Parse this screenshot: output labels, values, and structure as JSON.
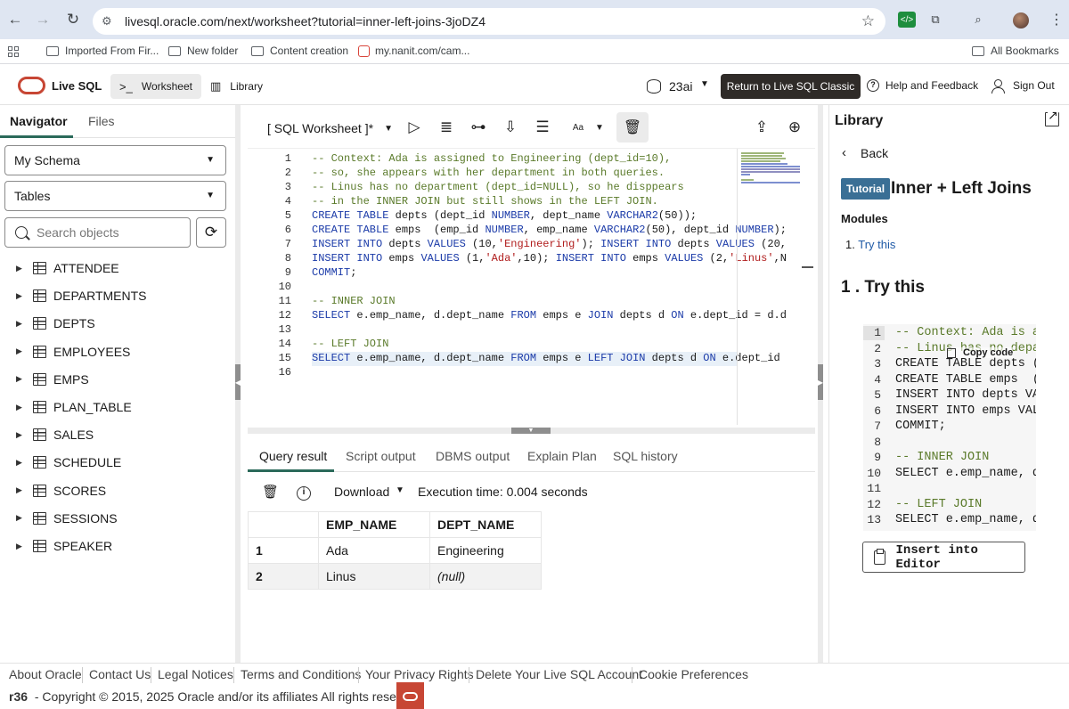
{
  "browser": {
    "url": "livesql.oracle.com/next/worksheet?tutorial=inner-left-joins-3joDZ4",
    "bookmarks": [
      "Imported From Fir...",
      "New folder",
      "Content creation",
      "my.nanit.com/cam..."
    ],
    "all_bookmarks": "All Bookmarks"
  },
  "app": {
    "name": "Live SQL",
    "tabs": [
      "Worksheet",
      "Library"
    ],
    "db_version": "23ai",
    "classic_button": "Return to Live SQL Classic",
    "help": "Help and Feedback",
    "signout": "Sign Out"
  },
  "navigator": {
    "tabs": [
      "Navigator",
      "Files"
    ],
    "schema": "My Schema",
    "object_type": "Tables",
    "search_placeholder": "Search objects",
    "tables": [
      "ATTENDEE",
      "DEPARTMENTS",
      "DEPTS",
      "EMPLOYEES",
      "EMPS",
      "PLAN_TABLE",
      "SALES",
      "SCHEDULE",
      "SCORES",
      "SESSIONS",
      "SPEAKER"
    ]
  },
  "worksheet": {
    "title": "[ SQL Worksheet ]*",
    "font_label": "Aa",
    "line_numbers": [
      "1",
      "2",
      "3",
      "4",
      "5",
      "6",
      "7",
      "8",
      "9",
      "10",
      "11",
      "12",
      "13",
      "14",
      "15",
      "16"
    ],
    "result_tabs": [
      "Query result",
      "Script output",
      "DBMS output",
      "Explain Plan",
      "SQL history"
    ],
    "download": "Download",
    "execution": "Execution time: 0.004 seconds",
    "columns": [
      "EMP_NAME",
      "DEPT_NAME"
    ],
    "rows": [
      {
        "n": "1",
        "emp": "Ada",
        "dept": "Engineering"
      },
      {
        "n": "2",
        "emp": "Linus",
        "dept": "(null)"
      }
    ]
  },
  "library": {
    "title": "Library",
    "back": "Back",
    "badge": "Tutorial",
    "tutorial_title": "Inner + Left Joins",
    "modules_heading": "Modules",
    "module_number": "1.",
    "module_link": "Try this",
    "section_heading": "1 . Try this",
    "code_line_numbers": [
      "1",
      "2",
      "3",
      "4",
      "5",
      "6",
      "7",
      "8",
      "9",
      "10",
      "11",
      "12",
      "13"
    ],
    "code_lines": [
      "-- Context: Ada is as",
      "-- Linus has no depar",
      "CREATE TABLE depts (d",
      "CREATE TABLE emps  (e",
      "INSERT INTO depts VAL",
      "INSERT INTO emps VALU",
      "COMMIT;",
      "",
      "-- INNER JOIN",
      "SELECT e.emp_name, d.",
      "",
      "-- LEFT JOIN",
      "SELECT e.emp_name, d."
    ],
    "copy_code": "Copy code",
    "insert_button": "Insert into Editor"
  },
  "footer": {
    "links": [
      "About Oracle",
      "Contact Us",
      "Legal Notices",
      "Terms and Conditions",
      "Your Privacy Rights",
      "Delete Your Live SQL Account",
      "Cookie Preferences"
    ],
    "build": "r36",
    "copyright": "-  Copyright © 2015, 2025 Oracle and/or its affiliates All rights reserved"
  },
  "icons": {
    "brand_color": "#c74634",
    "accent": "#2b6a5a",
    "badge_color": "#3a6f95"
  }
}
